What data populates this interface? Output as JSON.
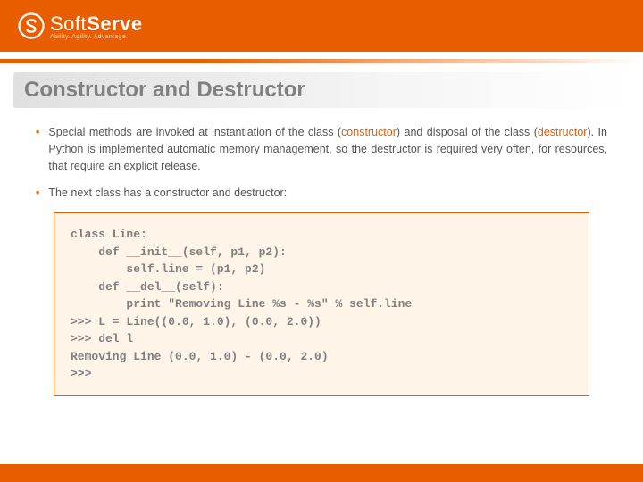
{
  "header": {
    "logo_soft": "Soft",
    "logo_serve": "Serve",
    "tagline": "Ability. Agility. Advantage."
  },
  "title": "Constructor and Destructor",
  "bullets": [
    {
      "pre": "Special methods are invoked at instantiation of the class (",
      "kw1": "constructor",
      "mid": ") and disposal of the class (",
      "kw2": "destructor",
      "post": "). In Python is implemented automatic memory management, so the destructor is required very often, for resources, that require an explicit release."
    },
    {
      "text": " The next class has a constructor and destructor:"
    }
  ],
  "code": "class Line:\n    def __init__(self, p1, p2):\n        self.line = (p1, p2)\n    def __del__(self):\n        print \"Removing Line %s - %s\" % self.line\n>>> L = Line((0.0, 1.0), (0.0, 2.0))\n>>> del l\nRemoving Line (0.0, 1.0) - (0.0, 2.0)\n>>>"
}
